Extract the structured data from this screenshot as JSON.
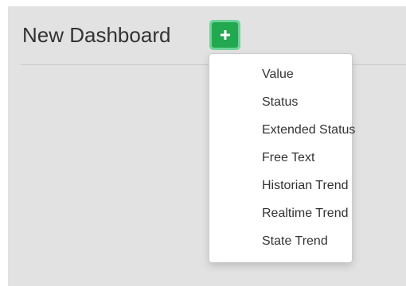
{
  "header": {
    "title": "New Dashboard",
    "add_button_icon": "plus-icon"
  },
  "add_menu": {
    "items": [
      "Value",
      "Status",
      "Extended Status",
      "Free Text",
      "Historian Trend",
      "Realtime Trend",
      "State Trend"
    ]
  },
  "colors": {
    "button_green": "#22a84e",
    "button_focus_ring": "#6ed49a",
    "panel_background": "#e2e2e2",
    "text": "#333333"
  }
}
